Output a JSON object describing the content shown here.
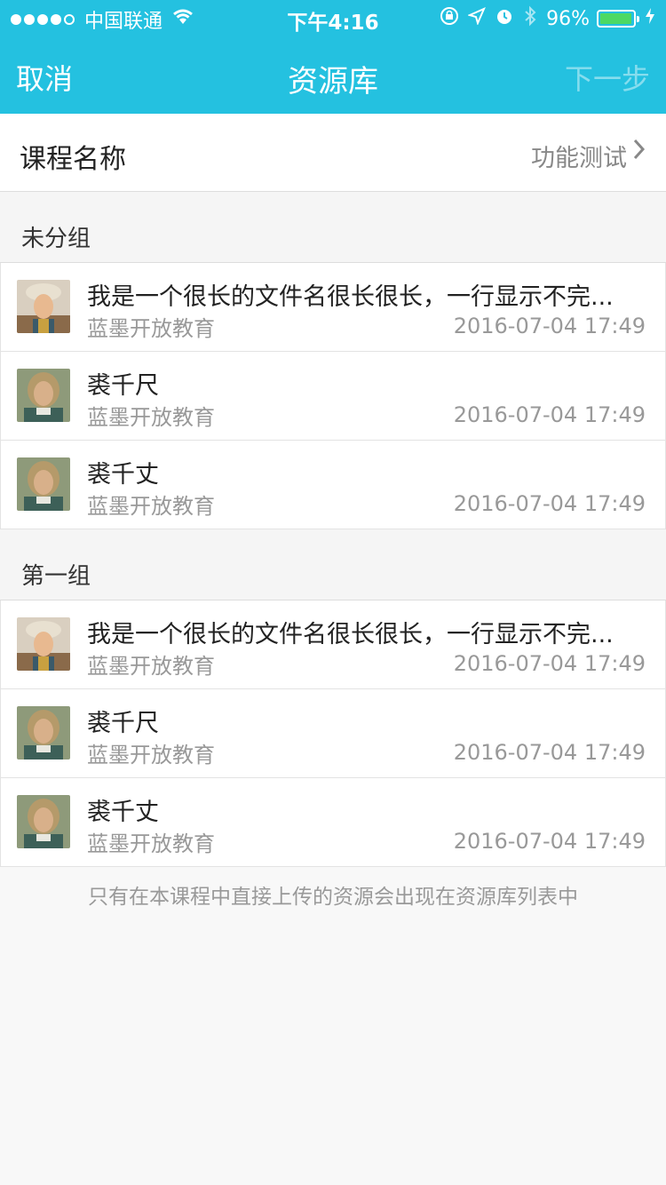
{
  "status_bar": {
    "carrier": "中国联通",
    "time": "下午4:16",
    "battery": "96%",
    "battery_level": 0.96,
    "icons": [
      "signal-dots-icon",
      "wifi-icon",
      "rotation-lock-icon",
      "location-icon",
      "alarm-icon",
      "bluetooth-icon",
      "battery-icon",
      "charging-icon"
    ]
  },
  "nav": {
    "cancel_label": "取消",
    "title": "资源库",
    "next_label": "下一步"
  },
  "course": {
    "label": "课程名称",
    "value": "功能测试"
  },
  "groups": [
    {
      "title": "未分组",
      "items": [
        {
          "name": "我是一个很长的文件名很长很长，一行显示不完...",
          "org": "蓝墨开放教育",
          "date": "2016-07-04 17:49",
          "avatar": "avatar-hat"
        },
        {
          "name": "裘千尺",
          "org": "蓝墨开放教育",
          "date": "2016-07-04 17:49",
          "avatar": "avatar-old"
        },
        {
          "name": "裘千丈",
          "org": "蓝墨开放教育",
          "date": "2016-07-04 17:49",
          "avatar": "avatar-old"
        }
      ]
    },
    {
      "title": "第一组",
      "items": [
        {
          "name": "我是一个很长的文件名很长很长，一行显示不完...",
          "org": "蓝墨开放教育",
          "date": "2016-07-04 17:49",
          "avatar": "avatar-hat"
        },
        {
          "name": "裘千尺",
          "org": "蓝墨开放教育",
          "date": "2016-07-04 17:49",
          "avatar": "avatar-old"
        },
        {
          "name": "裘千丈",
          "org": "蓝墨开放教育",
          "date": "2016-07-04 17:49",
          "avatar": "avatar-old"
        }
      ]
    }
  ],
  "footer_note": "只有在本课程中直接上传的资源会出现在资源库列表中",
  "colors": {
    "header": "#24c1e0",
    "battery_fill": "#4cd964"
  }
}
